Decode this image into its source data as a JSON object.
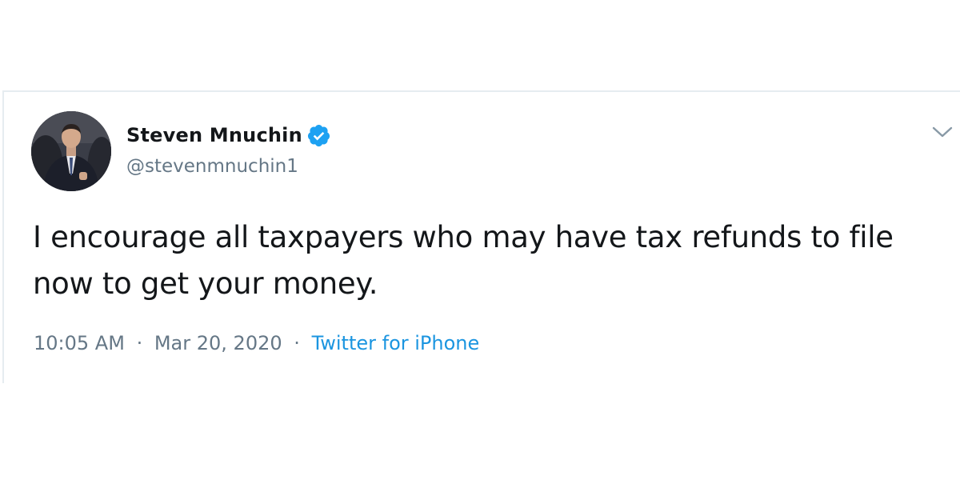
{
  "tweet": {
    "author": {
      "display_name": "Steven Mnuchin",
      "handle": "@stevenmnuchin1",
      "verified": true,
      "avatar": "avatar-photo"
    },
    "text": "I encourage all taxpayers who may have tax refunds to file now to get your money.",
    "time": "10:05 AM",
    "date": "Mar 20, 2020",
    "separator": "·",
    "source": "Twitter for iPhone",
    "menu_icon": "chevron-down-icon"
  },
  "colors": {
    "verified": "#1da1f2",
    "link": "#1b95e0",
    "text": "#14171a",
    "secondary": "#657786",
    "border": "#e6ecf0"
  }
}
